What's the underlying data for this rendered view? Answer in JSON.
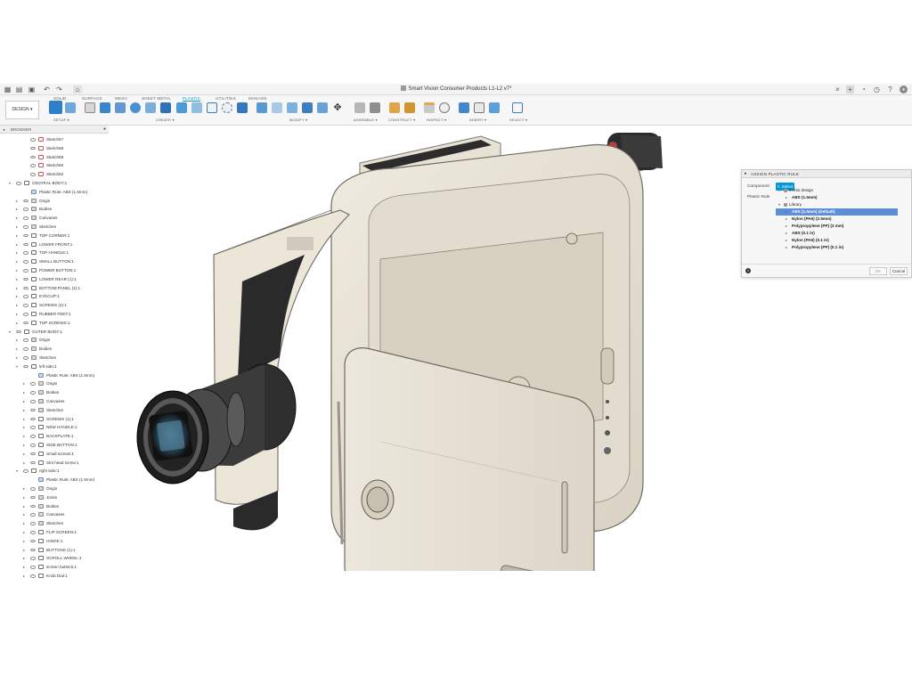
{
  "app": {
    "document_title": "Smart Vision Consumer Products L1-L2 v7*"
  },
  "ribbon": {
    "workspace_label": "DESIGN ▾",
    "tabs": [
      "SOLID",
      "SURFACE",
      "MESH",
      "SHEET METAL",
      "PLASTIC",
      "UTILITIES",
      "MANAGE"
    ],
    "active_tab": "PLASTIC",
    "groups": [
      "SETUP ▾",
      "CREATE ▾",
      "MODIFY ▾",
      "ASSEMBLE ▾",
      "CONSTRUCT ▾",
      "INSPECT ▾",
      "INSERT ▾",
      "SELECT ▾"
    ]
  },
  "browser": {
    "title": "BROWSER",
    "rows": [
      {
        "label": "Sketch57",
        "indent": 3,
        "icon": "sketch-icon",
        "expandable": false
      },
      {
        "label": "Sketch58",
        "indent": 3,
        "icon": "sketch-icon",
        "expandable": false
      },
      {
        "label": "Sketch59",
        "indent": 3,
        "icon": "sketch-icon",
        "expandable": false
      },
      {
        "label": "Sketch60",
        "indent": 3,
        "icon": "sketch-icon",
        "expandable": false
      },
      {
        "label": "Sketch62",
        "indent": 3,
        "icon": "sketch-icon",
        "expandable": false
      },
      {
        "label": "CENTRAL BODY:1",
        "indent": 1,
        "icon": "component-icon",
        "expandable": true,
        "expanded": true
      },
      {
        "label": "Plastic Rule: ABS (1.5mm)",
        "indent": 2,
        "icon": "plastic-rule-icon",
        "expandable": false
      },
      {
        "label": "Origin",
        "indent": 2,
        "icon": "folder-icon",
        "expandable": true
      },
      {
        "label": "Bodies",
        "indent": 2,
        "icon": "folder-icon",
        "expandable": true
      },
      {
        "label": "Canvases",
        "indent": 2,
        "icon": "folder-icon",
        "expandable": true
      },
      {
        "label": "Sketches",
        "indent": 2,
        "icon": "folder-icon",
        "expandable": true
      },
      {
        "label": "TOP CORNER:1",
        "indent": 2,
        "icon": "component-icon",
        "expandable": true
      },
      {
        "label": "LOWER FRONT:1",
        "indent": 2,
        "icon": "component-icon",
        "expandable": true
      },
      {
        "label": "TOP HANDLE:1",
        "indent": 2,
        "icon": "component-icon",
        "expandable": true
      },
      {
        "label": "SMALL BUTTON:1",
        "indent": 2,
        "icon": "component-icon",
        "expandable": true
      },
      {
        "label": "POWER BUTTON:1",
        "indent": 2,
        "icon": "component-icon",
        "expandable": true
      },
      {
        "label": "LOWER REAR (1):1",
        "indent": 2,
        "icon": "component-icon",
        "expandable": true
      },
      {
        "label": "BOTTOM PANEL (1):1",
        "indent": 2,
        "icon": "component-icon",
        "expandable": true
      },
      {
        "label": "EYECUP:1",
        "indent": 2,
        "icon": "component-icon",
        "expandable": true
      },
      {
        "label": "SCREWS (2):1",
        "indent": 2,
        "icon": "component-icon",
        "expandable": true
      },
      {
        "label": "RUBBER FEET:1",
        "indent": 2,
        "icon": "component-icon",
        "expandable": true
      },
      {
        "label": "TOP SCREWS:1",
        "indent": 2,
        "icon": "component-icon",
        "expandable": true
      },
      {
        "label": "OUTER BODY:1",
        "indent": 1,
        "icon": "component-icon",
        "expandable": true,
        "expanded": true
      },
      {
        "label": "Origin",
        "indent": 2,
        "icon": "folder-icon",
        "expandable": true
      },
      {
        "label": "Bodies",
        "indent": 2,
        "icon": "folder-icon",
        "expandable": true
      },
      {
        "label": "Sketches",
        "indent": 2,
        "icon": "folder-icon",
        "expandable": true
      },
      {
        "label": "left side:1",
        "indent": 2,
        "icon": "component-icon",
        "expandable": true,
        "expanded": true
      },
      {
        "label": "Plastic Rule: ABS (1.5mm)",
        "indent": 3,
        "icon": "plastic-rule-icon",
        "expandable": false
      },
      {
        "label": "Origin",
        "indent": 3,
        "icon": "folder-icon",
        "expandable": true
      },
      {
        "label": "Bodies",
        "indent": 3,
        "icon": "folder-icon",
        "expandable": true
      },
      {
        "label": "Canvases",
        "indent": 3,
        "icon": "folder-icon",
        "expandable": true
      },
      {
        "label": "Sketches",
        "indent": 3,
        "icon": "folder-icon",
        "expandable": true
      },
      {
        "label": "SCREWS (1):1",
        "indent": 3,
        "icon": "component-icon",
        "expandable": true
      },
      {
        "label": "NEW HANDLE:1",
        "indent": 3,
        "icon": "component-icon",
        "expandable": true
      },
      {
        "label": "BACKPLATE:1",
        "indent": 3,
        "icon": "component-icon",
        "expandable": true
      },
      {
        "label": "SIDE BUTTON:1",
        "indent": 3,
        "icon": "component-icon",
        "expandable": true
      },
      {
        "label": "Small screws:1",
        "indent": 3,
        "icon": "component-icon",
        "expandable": true
      },
      {
        "label": "Slot head screw:1",
        "indent": 3,
        "icon": "component-icon",
        "expandable": true
      },
      {
        "label": "right side:1",
        "indent": 2,
        "icon": "component-icon",
        "expandable": true,
        "expanded": true
      },
      {
        "label": "Plastic Rule: ABS (1.5mm)",
        "indent": 3,
        "icon": "plastic-rule-icon",
        "expandable": false
      },
      {
        "label": "Origin",
        "indent": 3,
        "icon": "folder-icon",
        "expandable": true
      },
      {
        "label": "Joints",
        "indent": 3,
        "icon": "folder-icon",
        "expandable": true
      },
      {
        "label": "Bodies",
        "indent": 3,
        "icon": "folder-icon",
        "expandable": true
      },
      {
        "label": "Canvases",
        "indent": 3,
        "icon": "folder-icon",
        "expandable": true
      },
      {
        "label": "Sketches",
        "indent": 3,
        "icon": "folder-icon",
        "expandable": true
      },
      {
        "label": "FLIP SCREEN:1",
        "indent": 3,
        "icon": "component-icon",
        "expandable": true
      },
      {
        "label": "HINGE:1",
        "indent": 3,
        "icon": "component-icon",
        "expandable": true
      },
      {
        "label": "BUTTONS (1):1",
        "indent": 3,
        "icon": "component-icon",
        "expandable": true
      },
      {
        "label": "SCROLL WHEEL:1",
        "indent": 3,
        "icon": "component-icon",
        "expandable": true
      },
      {
        "label": "screen buttons:1",
        "indent": 3,
        "icon": "component-icon",
        "expandable": true
      },
      {
        "label": "Knob Dial:1",
        "indent": 3,
        "icon": "component-icon",
        "expandable": true
      }
    ]
  },
  "dialog": {
    "title": "ASSIGN PLASTIC RULE",
    "component_label": "Component",
    "select_label": "Select",
    "plastic_rule_label": "Plastic Rule",
    "rules": [
      {
        "label": "In this design",
        "level": 0,
        "expandable": true,
        "bold": false,
        "selected": false
      },
      {
        "label": "ABS (1.5mm)",
        "level": 1,
        "expandable": false,
        "bold": true,
        "selected": false
      },
      {
        "label": "Library",
        "level": 0,
        "expandable": true,
        "bold": false,
        "selected": false
      },
      {
        "label": "ABS (1.5mm) (Default)",
        "level": 1,
        "expandable": false,
        "bold": true,
        "selected": true
      },
      {
        "label": "Nylon (PA6) (2.5mm)",
        "level": 1,
        "expandable": false,
        "bold": true,
        "selected": false
      },
      {
        "label": "Polypropylene (PP) (3 mm)",
        "level": 1,
        "expandable": false,
        "bold": true,
        "selected": false
      },
      {
        "label": "ABS (0.1 in)",
        "level": 1,
        "expandable": false,
        "bold": true,
        "selected": false
      },
      {
        "label": "Nylon (PA6) (0.1 in)",
        "level": 1,
        "expandable": false,
        "bold": true,
        "selected": false
      },
      {
        "label": "Polypropylene (PP) (0.1 in)",
        "level": 1,
        "expandable": false,
        "bold": true,
        "selected": false
      }
    ],
    "ok_label": "OK",
    "cancel_label": "Cancel"
  },
  "colors": {
    "accent": "#0696d7",
    "selection": "#5b8fd6",
    "model_body": "#e6e0d3",
    "model_shade": "#c9c2b3",
    "model_dark": "#2b2b2b"
  }
}
